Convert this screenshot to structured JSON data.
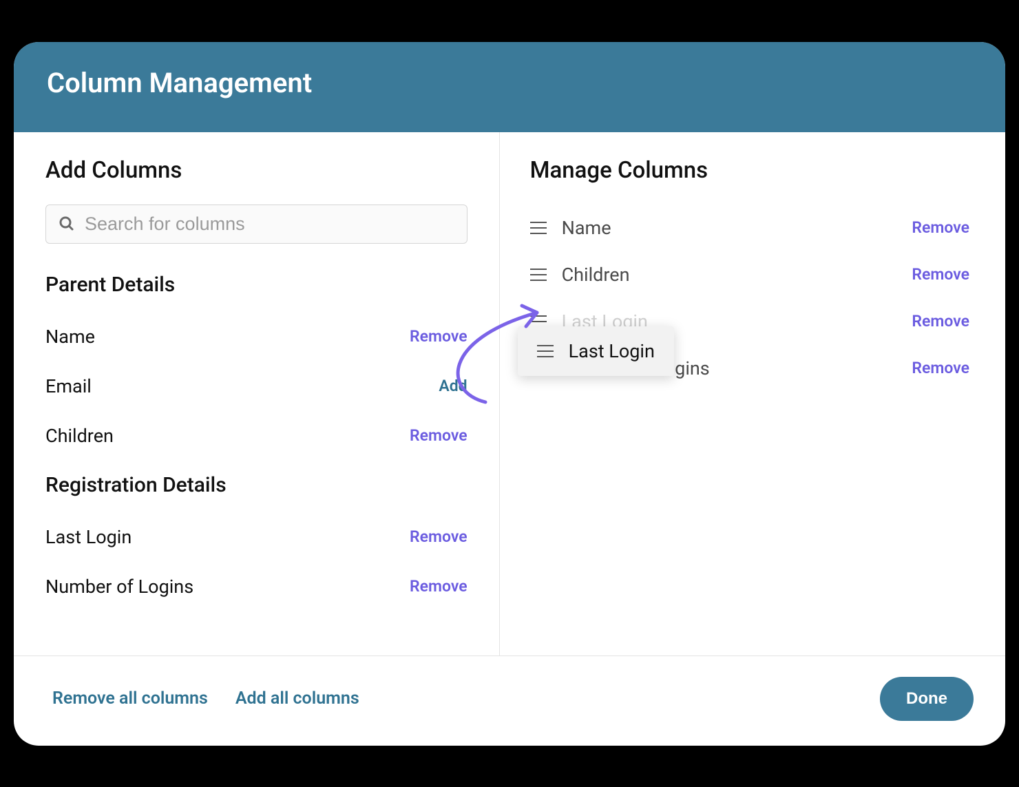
{
  "header": {
    "title": "Column Management"
  },
  "left": {
    "title": "Add Columns",
    "search_placeholder": "Search for columns",
    "groups": [
      {
        "title": "Parent Details",
        "items": [
          {
            "label": "Name",
            "action": "Remove",
            "action_type": "remove"
          },
          {
            "label": "Email",
            "action": "Add",
            "action_type": "add"
          },
          {
            "label": "Children",
            "action": "Remove",
            "action_type": "remove"
          }
        ]
      },
      {
        "title": "Registration Details",
        "items": [
          {
            "label": "Last Login",
            "action": "Remove",
            "action_type": "remove"
          },
          {
            "label": "Number of Logins",
            "action": "Remove",
            "action_type": "remove"
          }
        ]
      }
    ]
  },
  "right": {
    "title": "Manage Columns",
    "rows": [
      {
        "label": "Name",
        "action": "Remove"
      },
      {
        "label": "Children",
        "action": "Remove"
      },
      {
        "label": "Last Login",
        "action": "Remove"
      },
      {
        "label": "Number of Logins",
        "action": "Remove"
      }
    ],
    "dragging": {
      "label": "Last Login"
    }
  },
  "footer": {
    "remove_all": "Remove all columns",
    "add_all": "Add all columns",
    "done": "Done"
  }
}
